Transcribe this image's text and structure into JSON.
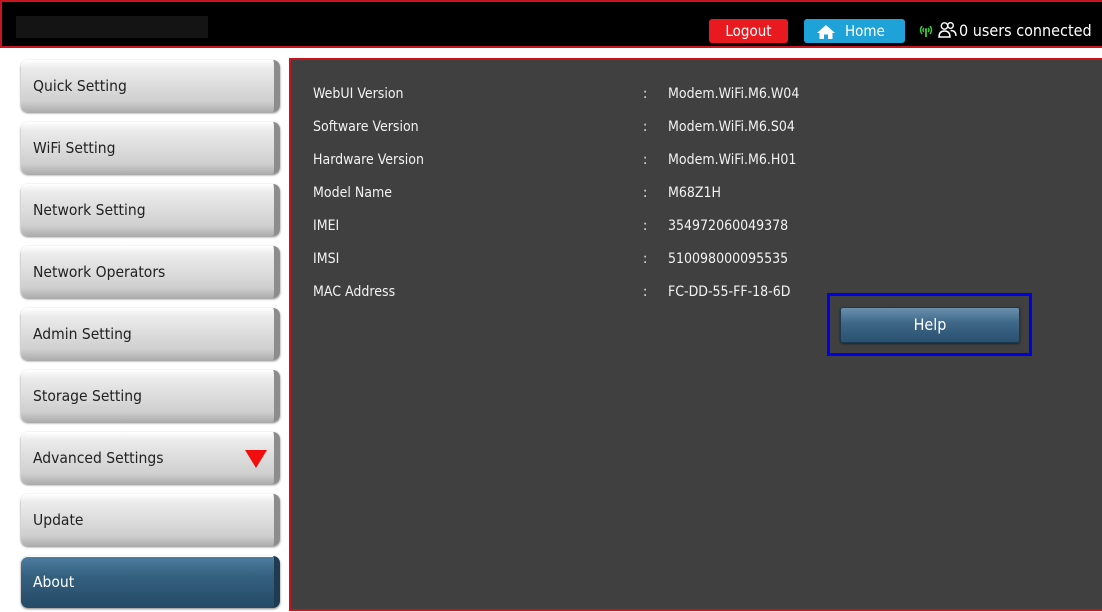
{
  "header": {
    "logout_label": "Logout",
    "home_label": "Home",
    "users_status": "0 users connected"
  },
  "sidebar": {
    "items": [
      {
        "label": "Quick Setting"
      },
      {
        "label": "WiFi Setting"
      },
      {
        "label": "Network Setting"
      },
      {
        "label": "Network Operators"
      },
      {
        "label": "Admin Setting"
      },
      {
        "label": "Storage Setting"
      },
      {
        "label": "Advanced Settings"
      },
      {
        "label": "Update"
      },
      {
        "label": "About"
      }
    ],
    "active": "About"
  },
  "about": {
    "rows": [
      {
        "label": "WebUI Version",
        "separator": ":",
        "value": "Modem.WiFi.M6.W04"
      },
      {
        "label": "Software Version",
        "separator": ":",
        "value": "Modem.WiFi.M6.S04"
      },
      {
        "label": "Hardware Version",
        "separator": ":",
        "value": "Modem.WiFi.M6.H01"
      },
      {
        "label": "Model Name",
        "separator": ":",
        "value": "M68Z1H"
      },
      {
        "label": "IMEI",
        "separator": ":",
        "value": "354972060049378"
      },
      {
        "label": "IMSI",
        "separator": ":",
        "value": "510098000095535"
      },
      {
        "label": "MAC Address",
        "separator": ":",
        "value": "FC-DD-55-FF-18-6D"
      }
    ],
    "help_label": "Help"
  },
  "icons": {
    "home": "home-icon",
    "signal": "signal-icon",
    "users": "users-icon",
    "expand": "triangle-down-icon"
  },
  "colors": {
    "frame_border": "#c8141e",
    "logout_bg": "#e8191f",
    "home_bg": "#1fa2d8",
    "signal": "#3ec93e",
    "active_nav": "#34607f",
    "content_bg": "#404040",
    "help_highlight": "#0000e6"
  }
}
